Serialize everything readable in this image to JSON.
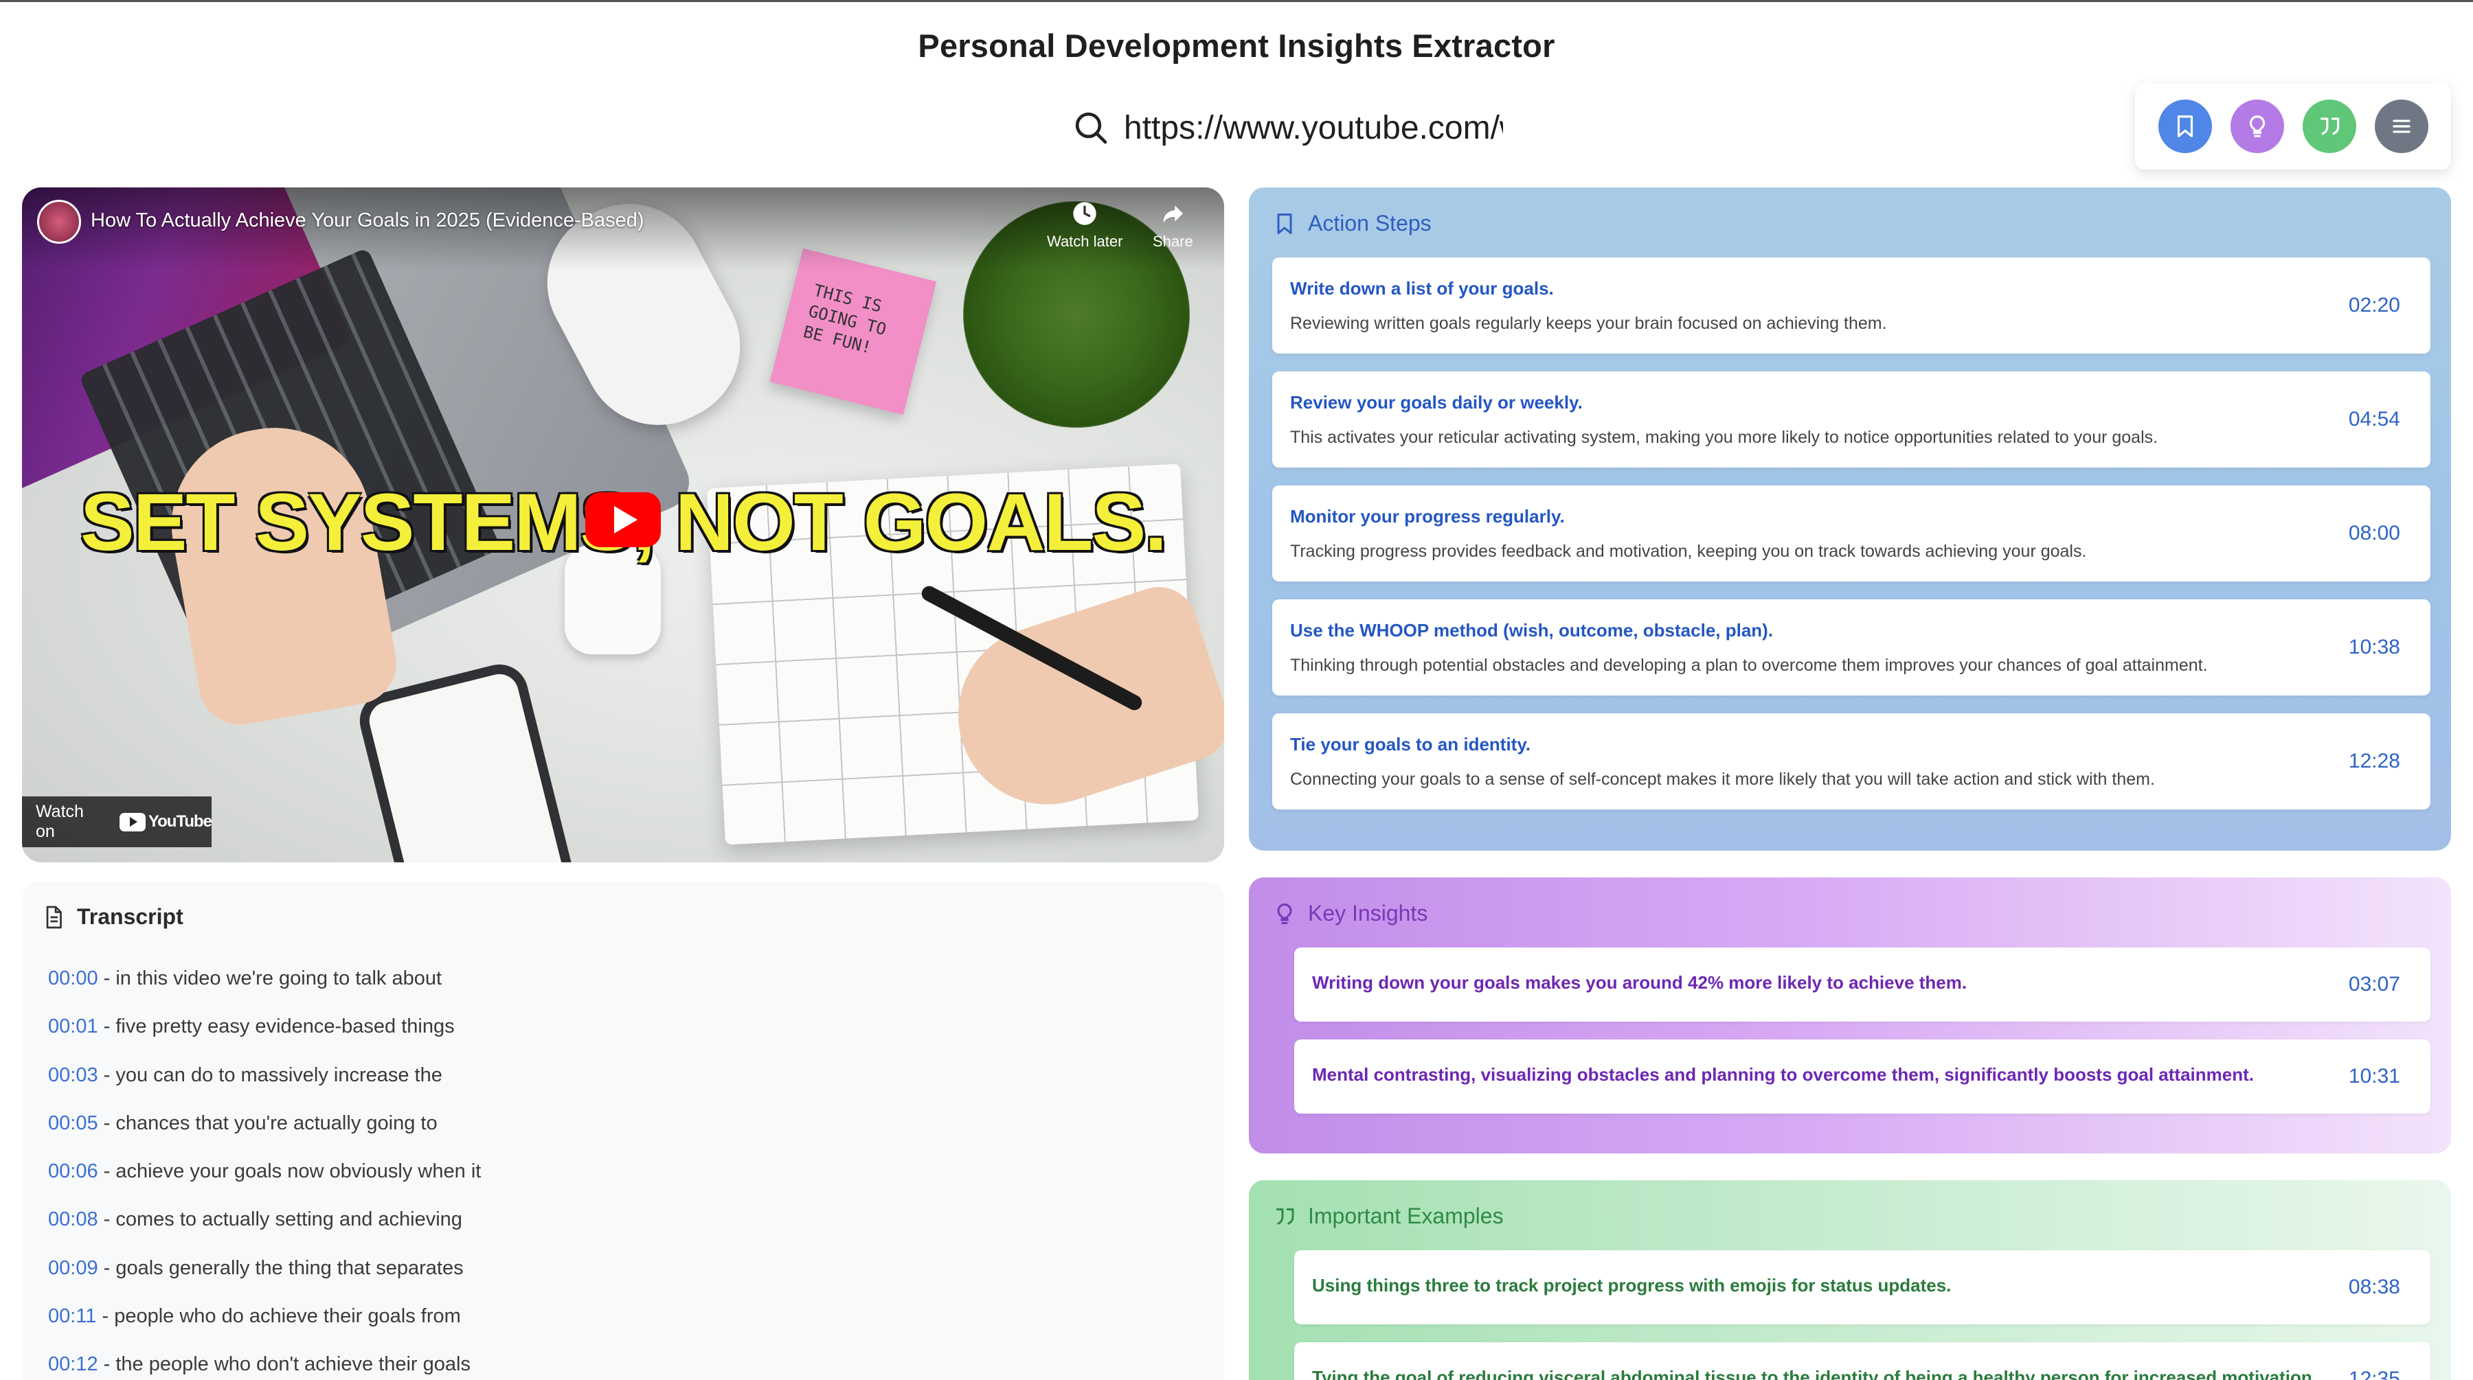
{
  "app": {
    "title": "Personal Development Insights Extractor"
  },
  "search": {
    "value": "https://www.youtube.com/w",
    "icon": "search-icon"
  },
  "toolbar": {
    "buttons": [
      {
        "name": "bookmark",
        "icon": "bookmark-icon",
        "color": "#4f86e8"
      },
      {
        "name": "lightbulb",
        "icon": "lightbulb-icon",
        "color": "#b47ae6"
      },
      {
        "name": "quote",
        "icon": "quote-icon",
        "color": "#5fc777"
      },
      {
        "name": "menu",
        "icon": "menu-icon",
        "color": "#707784"
      }
    ]
  },
  "video": {
    "title": "How To Actually Achieve Your Goals in 2025 (Evidence-Based)",
    "caption": "SET SYSTEMS, NOT GOALS.",
    "sticky_note": "THIS IS GOING TO BE FUN!",
    "watch_later": "Watch later",
    "share": "Share",
    "watch_on": "Watch on",
    "youtube": "YouTube"
  },
  "transcript": {
    "heading": "Transcript",
    "lines": [
      {
        "time": "00:00",
        "text": " - in this video we're going to talk about"
      },
      {
        "time": "00:01",
        "text": " - five pretty easy evidence-based things"
      },
      {
        "time": "00:03",
        "text": " - you can do to massively increase the"
      },
      {
        "time": "00:05",
        "text": " - chances that you're actually going to"
      },
      {
        "time": "00:06",
        "text": " - achieve your goals now obviously when it"
      },
      {
        "time": "00:08",
        "text": " - comes to actually setting and achieving"
      },
      {
        "time": "00:09",
        "text": " - goals generally the thing that separates"
      },
      {
        "time": "00:11",
        "text": " - people who do achieve their goals from"
      },
      {
        "time": "00:12",
        "text": " - the people who don't achieve their goals"
      }
    ]
  },
  "action_steps": {
    "heading": "Action Steps",
    "items": [
      {
        "title": "Write down a list of your goals.",
        "desc": "Reviewing written goals regularly keeps your brain focused on achieving them.",
        "time": "02:20"
      },
      {
        "title": "Review your goals daily or weekly.",
        "desc": "This activates your reticular activating system, making you more likely to notice opportunities related to your goals.",
        "time": "04:54"
      },
      {
        "title": "Monitor your progress regularly.",
        "desc": "Tracking progress provides feedback and motivation, keeping you on track towards achieving your goals.",
        "time": "08:00"
      },
      {
        "title": "Use the WHOOP method (wish, outcome, obstacle, plan).",
        "desc": "Thinking through potential obstacles and developing a plan to overcome them improves your chances of goal attainment.",
        "time": "10:38"
      },
      {
        "title": "Tie your goals to an identity.",
        "desc": "Connecting your goals to a sense of self-concept makes it more likely that you will take action and stick with them.",
        "time": "12:28"
      }
    ]
  },
  "key_insights": {
    "heading": "Key Insights",
    "items": [
      {
        "title": "Writing down your goals makes you around 42% more likely to achieve them.",
        "time": "03:07"
      },
      {
        "title": "Mental contrasting, visualizing obstacles and planning to overcome them, significantly boosts goal attainment.",
        "time": "10:31"
      }
    ]
  },
  "important_examples": {
    "heading": "Important Examples",
    "items": [
      {
        "title": "Using things three to track project progress with emojis for status updates.",
        "time": "08:38"
      },
      {
        "title": "Tying the goal of reducing visceral abdominal tissue to the identity of being a healthy person for increased motivation.",
        "time": "12:35"
      }
    ]
  }
}
